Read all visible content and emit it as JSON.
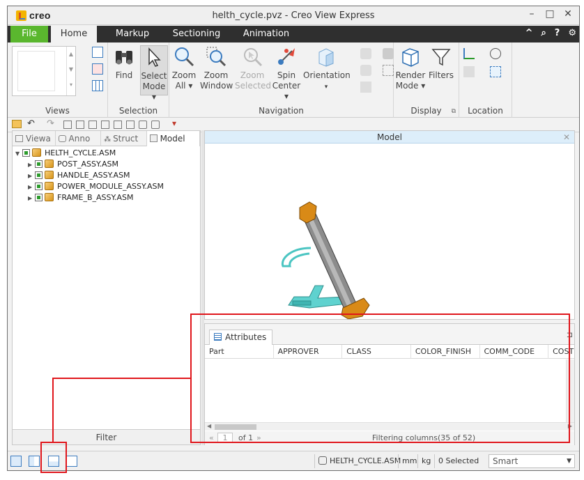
{
  "window": {
    "title": "helth_cycle.pvz - Creo View Express",
    "brand": "creo",
    "controls": [
      "–",
      "□",
      "✕"
    ]
  },
  "ribbon_tabs": [
    "File",
    "Home",
    "Markup",
    "Sectioning",
    "Animation"
  ],
  "ribbon_right_icons": [
    "^",
    "search-icon",
    "?",
    "gear-icon"
  ],
  "ribbon": {
    "views_label": "Views",
    "selection": {
      "label": "Selection",
      "find": "Find",
      "select_mode_1": "Select",
      "select_mode_2": "Mode ▾"
    },
    "navigation": {
      "label": "Navigation",
      "zoom_all_1": "Zoom",
      "zoom_all_2": "All ▾",
      "zoom_window_1": "Zoom",
      "zoom_window_2": "Window",
      "zoom_selected_1": "Zoom",
      "zoom_selected_2": "Selected",
      "spin_center_1": "Spin",
      "spin_center_2": "Center ▾",
      "orientation": "Orientation"
    },
    "display": {
      "label": "Display",
      "render_mode_1": "Render",
      "render_mode_2": "Mode ▾",
      "filters": "Filters"
    },
    "location_label": "Location"
  },
  "left_tabs": [
    "Viewa",
    "Anno",
    "Struct",
    "Model"
  ],
  "tree": {
    "root": "HELTH_CYCLE.ASM",
    "children": [
      "POST_ASSY.ASM",
      "HANDLE_ASSY.ASM",
      "POWER_MODULE_ASSY.ASM",
      "FRAME_B_ASSY.ASM"
    ]
  },
  "filter_label": "Filter",
  "model_panel": {
    "title": "Model",
    "close": "✕"
  },
  "attributes": {
    "tab_label": "Attributes",
    "columns": [
      "Part",
      "APPROVER",
      "CLASS",
      "COLOR_FINISH",
      "COMM_CODE",
      "COST"
    ],
    "pager_first": "«",
    "page_value": "1",
    "page_of": "of 1",
    "pager_next": "»",
    "filter_status": "Filtering columns(35 of 52)"
  },
  "status": {
    "model_name": "HELTH_CYCLE.ASM",
    "length_unit": "mm",
    "mass_unit": "kg",
    "selected": "0 Selected",
    "pick_mode": "Smart"
  },
  "colors": {
    "file_tab": "#5ab72e",
    "tab_bar": "#2f2f2f",
    "model_header": "#ddeefa",
    "annotation_red": "#e0151b",
    "part_orange": "#d98a17",
    "part_grey": "#8c8c8c",
    "part_cyan": "#5fd2cf"
  }
}
